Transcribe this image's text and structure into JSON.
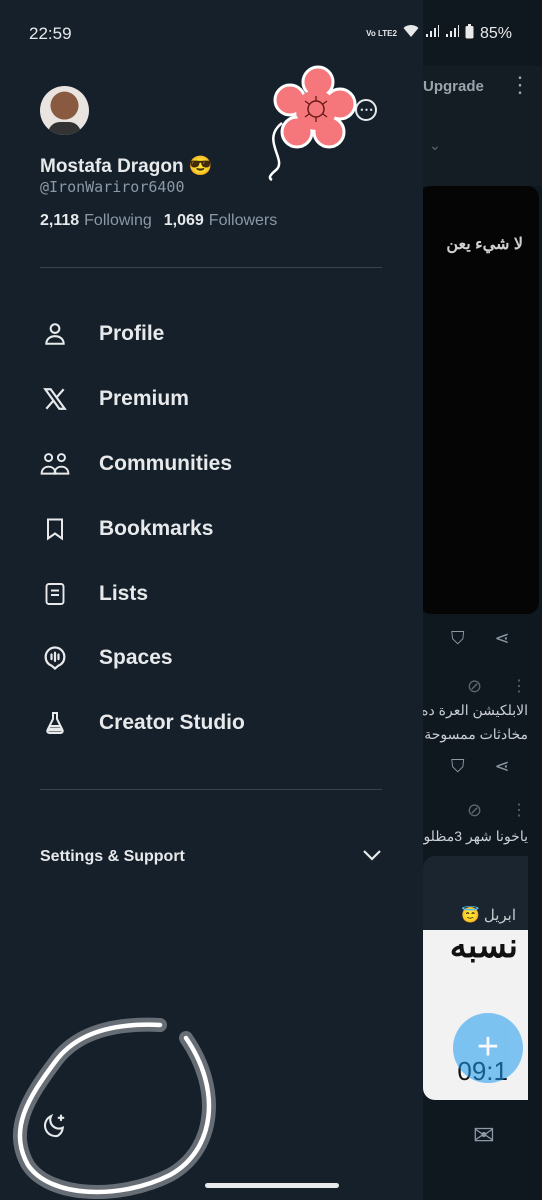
{
  "status_bar": {
    "time": "22:59",
    "network_label": "Vo LTE2",
    "battery": "85%"
  },
  "profile": {
    "display_name": "Mostafa Dragon 😎",
    "handle": "@IronWariror6400",
    "following_count": "2,118",
    "following_label": "Following",
    "followers_count": "1,069",
    "followers_label": "Followers"
  },
  "menu": {
    "items": [
      {
        "label": "Profile",
        "icon": "person-icon"
      },
      {
        "label": "Premium",
        "icon": "x-logo-icon"
      },
      {
        "label": "Communities",
        "icon": "communities-icon"
      },
      {
        "label": "Bookmarks",
        "icon": "bookmark-icon"
      },
      {
        "label": "Lists",
        "icon": "list-icon"
      },
      {
        "label": "Spaces",
        "icon": "spaces-icon"
      },
      {
        "label": "Creator Studio",
        "icon": "flask-icon"
      }
    ]
  },
  "settings": {
    "label": "Settings & Support"
  },
  "background": {
    "upgrade_label": "Upgrade",
    "card_text": "لا شيء يعن",
    "post1_line1": "الابلكيشن العرة ده",
    "post1_line2": "مخادثات ممسوحة",
    "post2_text": "ياخونا شهر 3مظلو",
    "quote_name": "ابريل 😇",
    "quote_img_text1": "نسبه",
    "quote_img_text2": "09:1"
  },
  "colors": {
    "background": "#15202b",
    "text_primary": "#e7e9ea",
    "text_secondary": "#8b98a5",
    "divider": "#38444d",
    "accent": "#1d9bf0"
  }
}
